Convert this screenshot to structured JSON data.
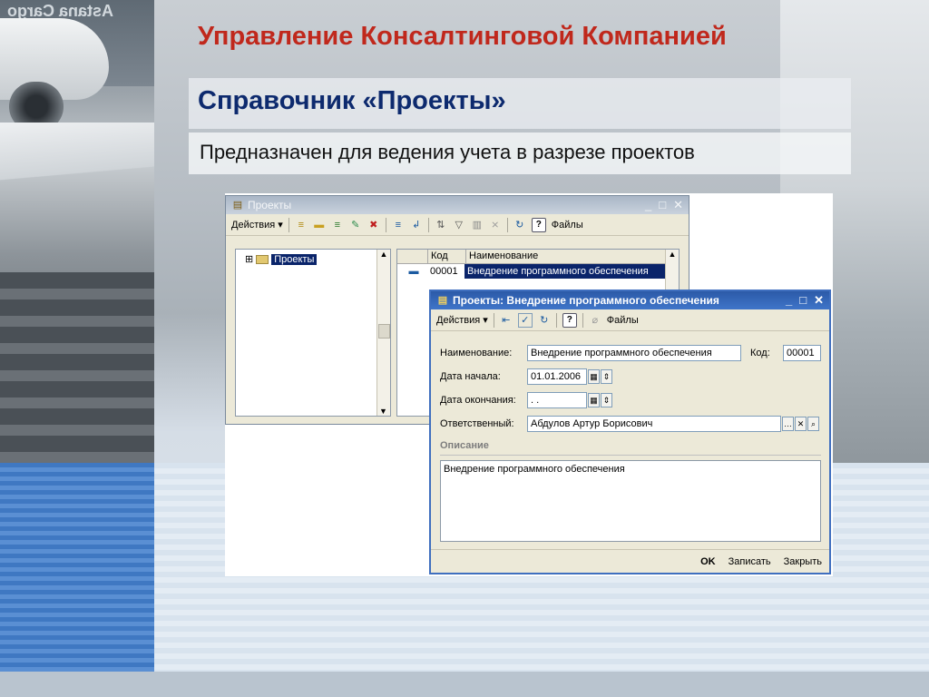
{
  "slide": {
    "title": "Управление Консалтинговой Компанией",
    "subtitle": "Справочник «Проекты»",
    "description": "Предназначен для ведения учета в разрезе проектов",
    "hangar_text": "Astana Cargo",
    "colors": {
      "title": "#c0281c",
      "subtitle": "#0d2a6e",
      "selection": "#0a246a",
      "active_titlebar": "#2c5aa8"
    }
  },
  "list_window": {
    "title": "Проекты",
    "window_buttons": [
      "_",
      "□",
      "✕"
    ],
    "toolbar": {
      "actions_label": "Действия ▾",
      "files_label": "Файлы"
    },
    "tree": {
      "expander": "⊞",
      "root_label": "Проекты"
    },
    "grid": {
      "columns": [
        "Код",
        "Наименование"
      ],
      "rows": [
        {
          "code": "00001",
          "name": "Внедрение программного обеспечения"
        }
      ]
    }
  },
  "edit_window": {
    "title": "Проекты: Внедрение программного обеспечения",
    "window_buttons": [
      "_",
      "□",
      "✕"
    ],
    "toolbar": {
      "actions_label": "Действия ▾",
      "files_label": "Файлы"
    },
    "fields": {
      "name_label": "Наименование:",
      "name_value": "Внедрение программного обеспечения",
      "code_label": "Код:",
      "code_value": "00001",
      "start_label": "Дата начала:",
      "start_value": "01.01.2006",
      "end_label": "Дата окончания:",
      "end_value": " .  .",
      "responsible_label": "Ответственный:",
      "responsible_value": "Абдулов Артур Борисович"
    },
    "description_section": "Описание",
    "description_value": "Внедрение программного обеспечения",
    "buttons": {
      "ok": "OK",
      "save": "Записать",
      "close": "Закрыть"
    }
  }
}
